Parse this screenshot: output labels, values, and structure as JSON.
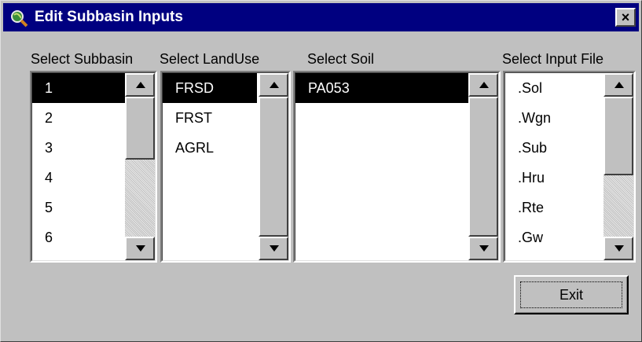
{
  "window": {
    "title": "Edit Subbasin Inputs",
    "close_label": "×"
  },
  "labels": {
    "subbasin": "Select Subbasin",
    "landuse": "Select LandUse",
    "soil": "Select Soil",
    "inputfile": "Select Input File"
  },
  "subbasins": {
    "items": [
      "1",
      "2",
      "3",
      "4",
      "5",
      "6"
    ],
    "selected": "1"
  },
  "landuses": {
    "items": [
      "FRSD",
      "FRST",
      "AGRL"
    ],
    "selected": "FRSD"
  },
  "soils": {
    "items": [
      "PA053"
    ],
    "selected": "PA053"
  },
  "input_files": {
    "items": [
      ".Sol",
      ".Wgn",
      ".Sub",
      ".Hru",
      ".Rte",
      ".Gw"
    ],
    "selected": ""
  },
  "buttons": {
    "exit": "Exit"
  },
  "colors": {
    "titlebar": "#000080",
    "face": "#c0c0c0",
    "selection": "#000000"
  },
  "icons": {
    "app": "magnifier-globe-icon",
    "scroll_up": "arrow-up-icon",
    "scroll_down": "arrow-down-icon"
  }
}
